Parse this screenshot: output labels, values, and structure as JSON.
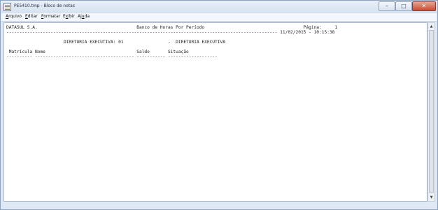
{
  "window": {
    "title": "PE5410.tmp - Bloco de notas",
    "minimize_glyph": "–",
    "maximize_glyph": "□",
    "close_glyph": "✕"
  },
  "menu": [
    {
      "prefix": "",
      "underline": "A",
      "rest": "rquivo"
    },
    {
      "prefix": "",
      "underline": "E",
      "rest": "ditar"
    },
    {
      "prefix": "",
      "underline": "F",
      "rest": "ormatar"
    },
    {
      "prefix": "E",
      "underline": "x",
      "rest": "ibir"
    },
    {
      "prefix": "Aj",
      "underline": "u",
      "rest": "da"
    }
  ],
  "report": {
    "lines": [
      "----------------------------------------------------------------------------------------------------------------------------------",
      "DATASUL S.A.                                      Banco de Horas Por Período                                      Página:     1",
      "-------------------------------------------------------------------------------------------------------- 11/02/2015 - 10:15:38",
      "",
      "                      DIRETORIA EXECUTIVA: 01                 -  DIRETORIA EXECUTIVA",
      "",
      " Matrícula Nome                                   Saldo       Situação",
      "---------- -------------------------------------- ----------- -------------------"
    ]
  },
  "scrollbar": {
    "up_glyph": "▲",
    "down_glyph": "▼"
  }
}
